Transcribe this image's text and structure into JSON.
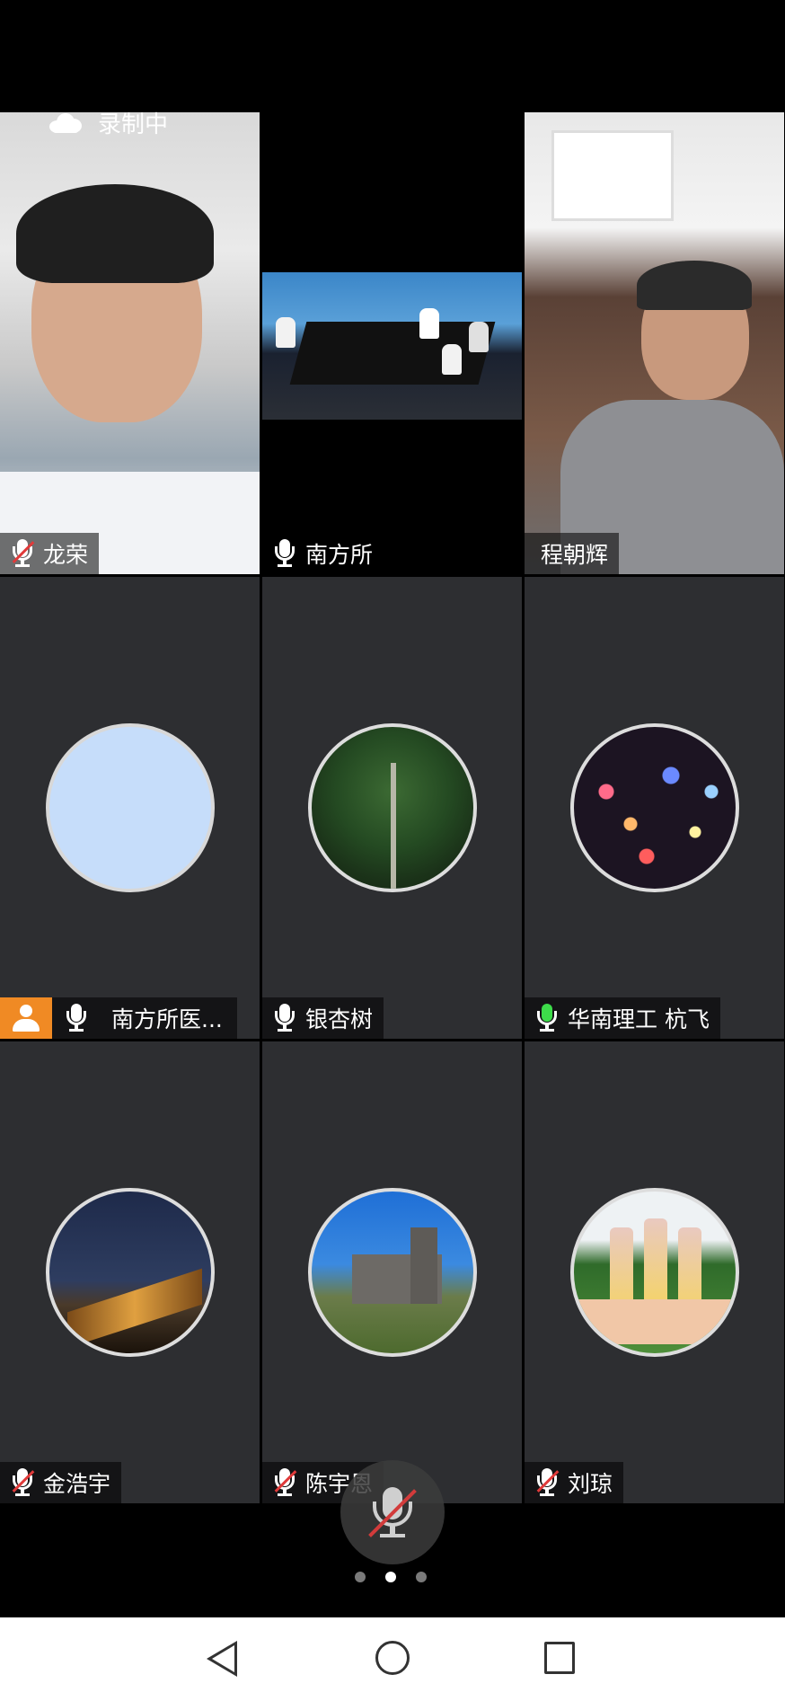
{
  "recording": {
    "label": "录制中"
  },
  "tiles": [
    {
      "name": "龙荣",
      "mic": "muted",
      "kind": "video"
    },
    {
      "name": "南方所",
      "mic": "on",
      "kind": "video"
    },
    {
      "name": "程朝辉",
      "kind": "video"
    },
    {
      "name": "南方所医...",
      "mic": "on",
      "kind": "avatar",
      "host": true
    },
    {
      "name": "银杏树",
      "mic": "on",
      "kind": "avatar"
    },
    {
      "name": "华南理工 杭飞",
      "mic": "speaking",
      "kind": "avatar"
    },
    {
      "name": "金浩宇",
      "mic": "muted",
      "kind": "avatar"
    },
    {
      "name": "陈宇恩",
      "mic": "muted",
      "kind": "avatar"
    },
    {
      "name": "刘琼",
      "mic": "muted",
      "kind": "avatar"
    }
  ],
  "pager": {
    "count": 3,
    "active_index": 1
  },
  "colors": {
    "tile_bg": "#2d2e31",
    "host_badge": "#f08a24",
    "speaking_mic": "#3ddc4a",
    "muted_slash": "#e03a3a"
  },
  "icons": {
    "self_mic": "mic-muted-icon",
    "nav": [
      "back-icon",
      "home-icon",
      "recents-icon"
    ]
  }
}
